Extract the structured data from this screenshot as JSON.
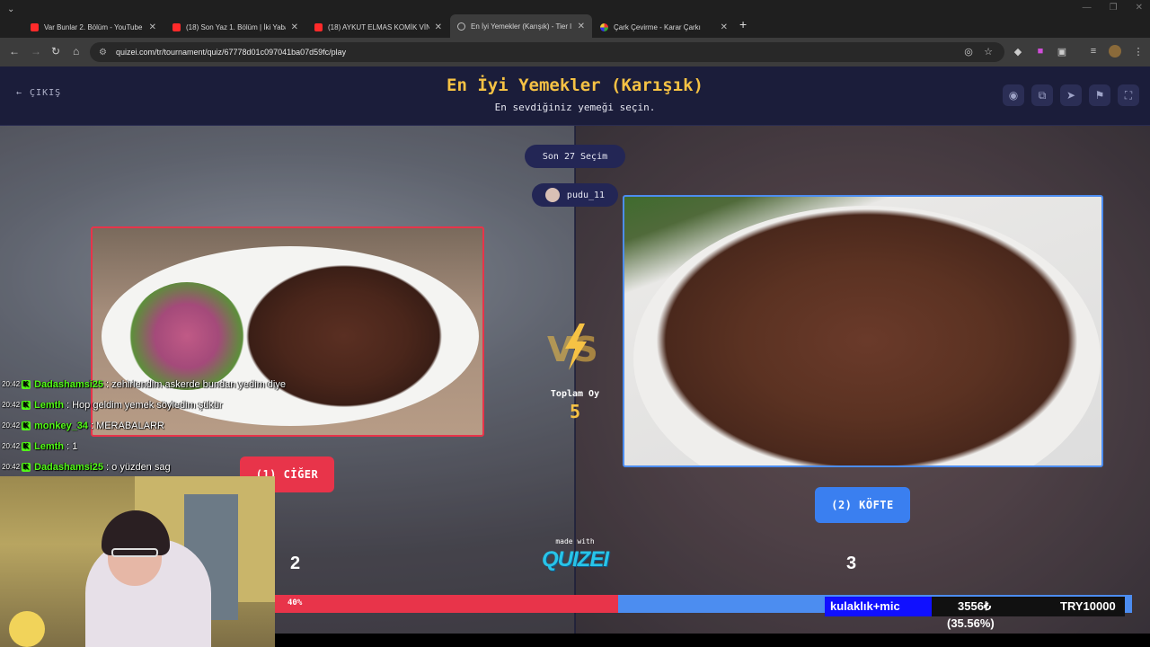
{
  "browser": {
    "tabs": [
      {
        "title": "Var Bunlar 2. Bölüm - YouTube",
        "icon": "youtube-icon"
      },
      {
        "title": "(18) Son Yaz 1. Bölüm | İki Yabancı",
        "icon": "youtube-icon"
      },
      {
        "title": "(18) AYKUT ELMAS KOMİK VİNE",
        "icon": "youtube-icon"
      },
      {
        "title": "En İyi Yemekler (Karışık) - Tier l",
        "icon": "globe-icon"
      },
      {
        "title": "Çark Çevirme - Karar Çarkı",
        "icon": "wheel-icon"
      }
    ],
    "url": "quizei.com/tr/tournament/quiz/67778d01c097041ba07d59fc/play"
  },
  "header": {
    "exit_label": "ÇIKIŞ",
    "title": "En İyi Yemekler (Karışık)",
    "subtitle": "En sevdiğiniz yemeği seçin.",
    "icons": [
      "eye-icon",
      "copy-icon",
      "send-icon",
      "flag-icon",
      "fullscreen-icon"
    ]
  },
  "round": {
    "label": "Son 27 Seçim",
    "player": "pudu_11",
    "total_label": "Toplam Oy",
    "total_votes": "5"
  },
  "options": {
    "left": {
      "label": "(1) CİĞER",
      "votes": "2",
      "border": "#e8344a"
    },
    "right": {
      "label": "(2) KÖFTE",
      "votes": "3",
      "border": "#4c8df0"
    }
  },
  "vote_bar": {
    "left_percent_label": "40%",
    "left_fraction": 0.4
  },
  "branding": {
    "made_with": "made with",
    "logo": "QUIZEI"
  },
  "chat": [
    {
      "time": "20:42",
      "nick": "Dadashamsi25",
      "message": ": zehirlendim askerde bundan yedim diye"
    },
    {
      "time": "20:42",
      "nick": "Lemth",
      "message": ": Hop geldim yemek söyledim şükür"
    },
    {
      "time": "20:42",
      "nick": "monkey_34",
      "message": ": MERABALARR"
    },
    {
      "time": "20:42",
      "nick": "Lemth",
      "message": ": 1"
    },
    {
      "time": "20:42",
      "nick": "Dadashamsi25",
      "message": ": o yüzden sag"
    }
  ],
  "goal": {
    "label": "kulaklık+mic",
    "amount": "3556₺",
    "percent_text": "(35.56%)",
    "target": "TRY10000",
    "fraction": 0.3556
  }
}
